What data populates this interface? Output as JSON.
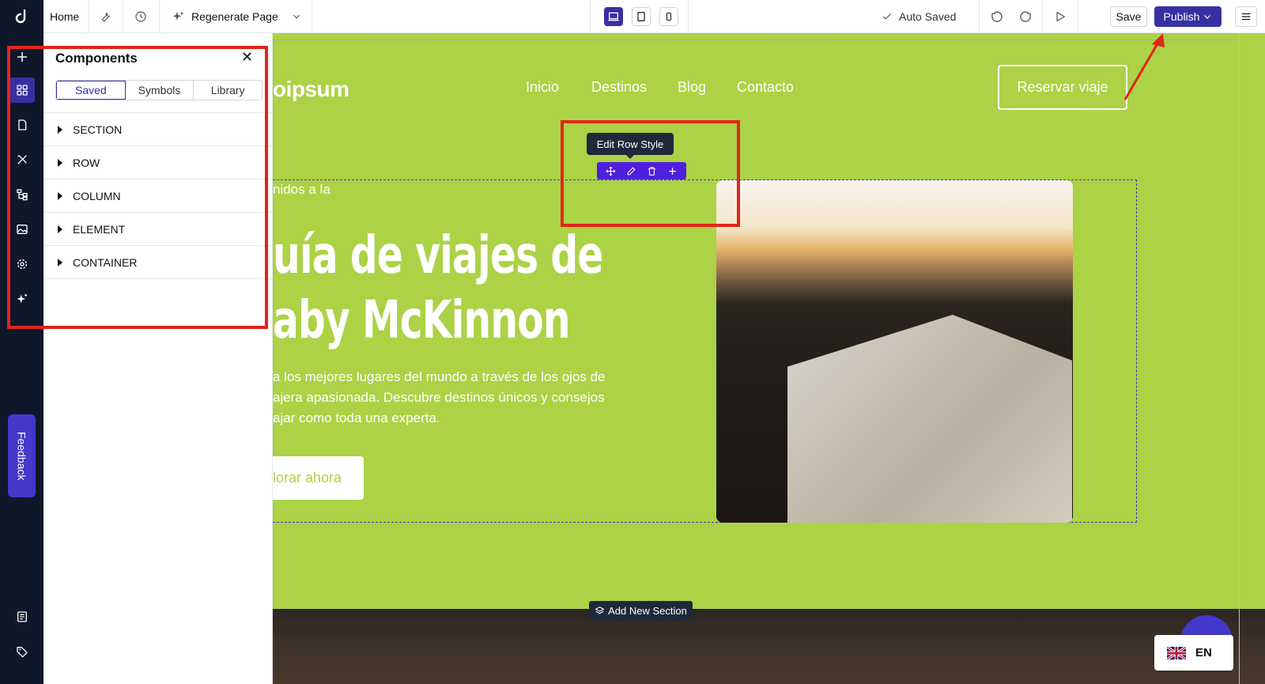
{
  "topbar": {
    "home": "Home",
    "regenerate": "Regenerate Page",
    "auto_saved": "Auto Saved",
    "save": "Save",
    "publish": "Publish"
  },
  "sidebar": {
    "feedback": "Feedback"
  },
  "panel": {
    "title": "Components",
    "tabs": [
      "Saved",
      "Symbols",
      "Library"
    ],
    "active_tab": "Saved",
    "sections": [
      "SECTION",
      "ROW",
      "COLUMN",
      "ELEMENT",
      "CONTAINER"
    ]
  },
  "site": {
    "brand": "oipsum",
    "nav": [
      "Inicio",
      "Destinos",
      "Blog",
      "Contacto"
    ],
    "cta": "Reservar viaje",
    "welcome": "nidos a la",
    "headline_1": "uía de viajes de",
    "headline_2": "aby McKinnon",
    "body_1": "a los mejores lugares del mundo a través de los ojos de",
    "body_2": "ajera apasionada. Descubre destinos únicos y consejos",
    "body_3": "ajar como toda una experta.",
    "explore": "lorar ahora"
  },
  "editor": {
    "tooltip": "Edit Row Style",
    "add_section": "Add New Section"
  },
  "language": {
    "code": "EN"
  },
  "colors": {
    "canvas_bg": "#acd246",
    "accent": "#3730a3",
    "annotation": "#e1251b"
  }
}
